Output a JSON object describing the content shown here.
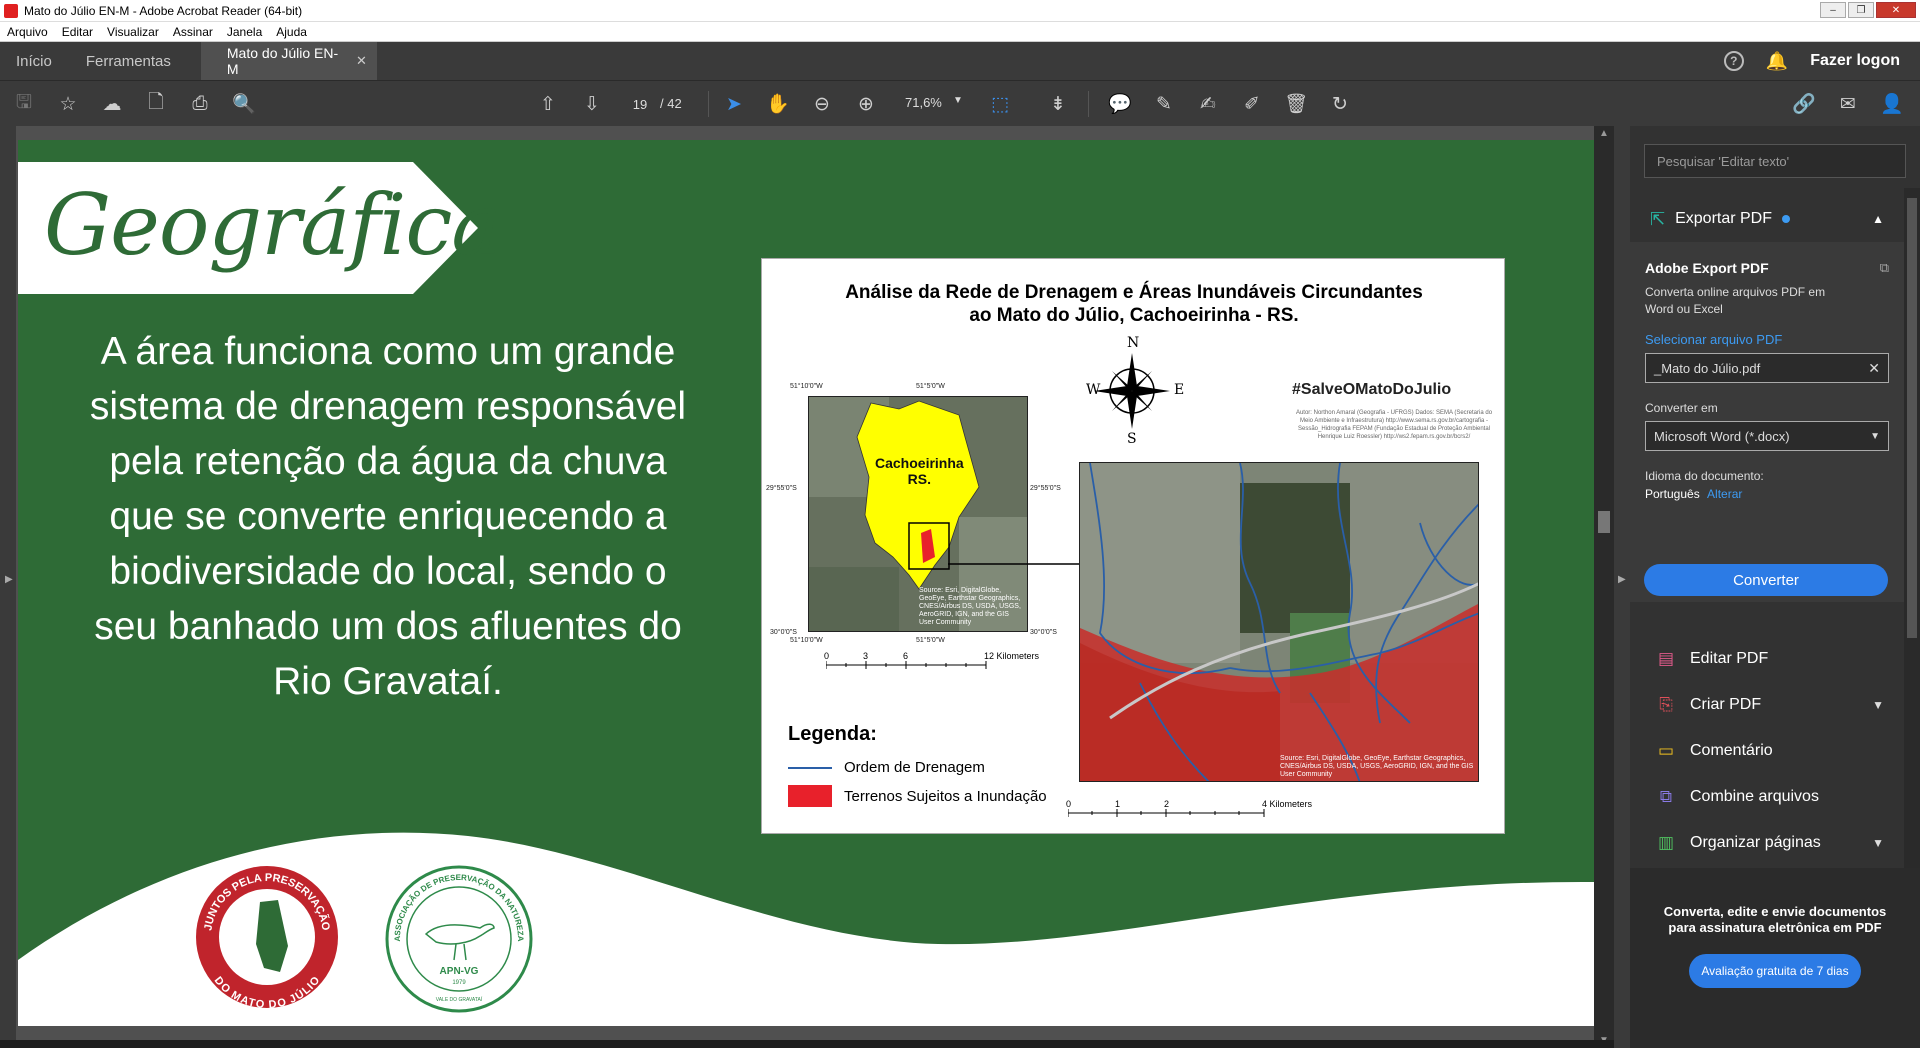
{
  "window": {
    "title": "Mato do Júlio EN-M - Adobe Acrobat Reader (64-bit)"
  },
  "menu": [
    "Arquivo",
    "Editar",
    "Visualizar",
    "Assinar",
    "Janela",
    "Ajuda"
  ],
  "tabs": {
    "home": "Início",
    "tools": "Ferramentas",
    "document": "Mato do Júlio EN-M",
    "logon": "Fazer logon"
  },
  "toolbar": {
    "page_current": "19",
    "page_total": "/ 42",
    "zoom": "71,6%"
  },
  "page": {
    "banner_title": "Geográfica",
    "body": "A área funciona como um grande sistema de drenagem responsável pela retenção da água da chuva que se converte enriquecendo a biodiversidade do local, sendo o seu banhado um dos afluentes do Rio Gravataí.",
    "map": {
      "title_line1": "Análise da Rede de Drenagem e Áreas Inundáveis Circundantes",
      "title_line2": "ao Mato do Júlio, Cachoeirinha - RS.",
      "hashtag": "#SalveOMatoDoJulio",
      "credits": "Autor: Northon Amaral (Geografia - UFRGS) Dados: SEMA (Secretaria do Meio Ambiente e Infraestrutura) http://www.sema.rs.gov.br/cartografia - Sessão_Hidrografia FEPAM (Fundação Estadual de Proteção Ambiental Henrique Luiz Roessler) http://ws2.fepam.rs.gov.br/bcrs2/",
      "inset_label_1": "Cachoeirinha",
      "inset_label_2": "RS.",
      "compass": {
        "n": "N",
        "s": "S",
        "e": "E",
        "w": "W"
      },
      "coords": {
        "x1": "51°10'0\"W",
        "x2": "51°5'0\"W",
        "y1": "29°55'0\"S",
        "y2": "30°0'0\"S"
      },
      "inset_scale": [
        "0",
        "3",
        "6",
        "12 Kilometers"
      ],
      "zoom_scale": [
        "0",
        "1",
        "2",
        "4 Kilometers"
      ],
      "esri": "Source: Esri, DigitalGlobe, GeoEye, Earthstar Geographics, CNES/Airbus DS, USDA, USGS, AeroGRID, IGN, and the GIS User Community",
      "legend_title": "Legenda:",
      "legend_items": [
        "Ordem de Drenagem",
        "Terrenos Sujeitos a Inundação"
      ],
      "colors": {
        "drainage": "#2a5fa8",
        "flood": "#e8212b",
        "municipality": "#ffff00"
      }
    },
    "logos": {
      "left": {
        "top_text": "JUNTOS PELA PRESERVAÇÃO",
        "bottom_text": "DO MATO DO JÚLIO"
      },
      "right": {
        "ring_text": "ASSOCIAÇÃO DE PRESERVAÇÃO DA NATUREZA",
        "initials": "APN-VG",
        "year": "1979",
        "place": "VALE DO GRAVATAÍ"
      }
    },
    "colors": {
      "background": "#2e6b36",
      "wave": "#ffffff"
    }
  },
  "right_panel": {
    "search_placeholder": "Pesquisar 'Editar texto'",
    "export_section": "Exportar PDF",
    "export_title": "Adobe Export PDF",
    "export_desc": "Converta online arquivos PDF em Word ou Excel",
    "select_file": "Selecionar arquivo PDF",
    "file_name": "_Mato do Júlio.pdf",
    "convert_to_label": "Converter em",
    "convert_to_value": "Microsoft Word (*.docx)",
    "doc_lang_label": "Idioma do documento:",
    "doc_lang_value": "Português",
    "change_link": "Alterar",
    "convert_button": "Converter",
    "tools": [
      "Editar PDF",
      "Criar PDF",
      "Comentário",
      "Combine arquivos",
      "Organizar páginas"
    ],
    "promo_text": "Converta, edite e envie documentos para assinatura eletrônica em PDF",
    "promo_button": "Avaliação gratuita de 7 dias"
  }
}
